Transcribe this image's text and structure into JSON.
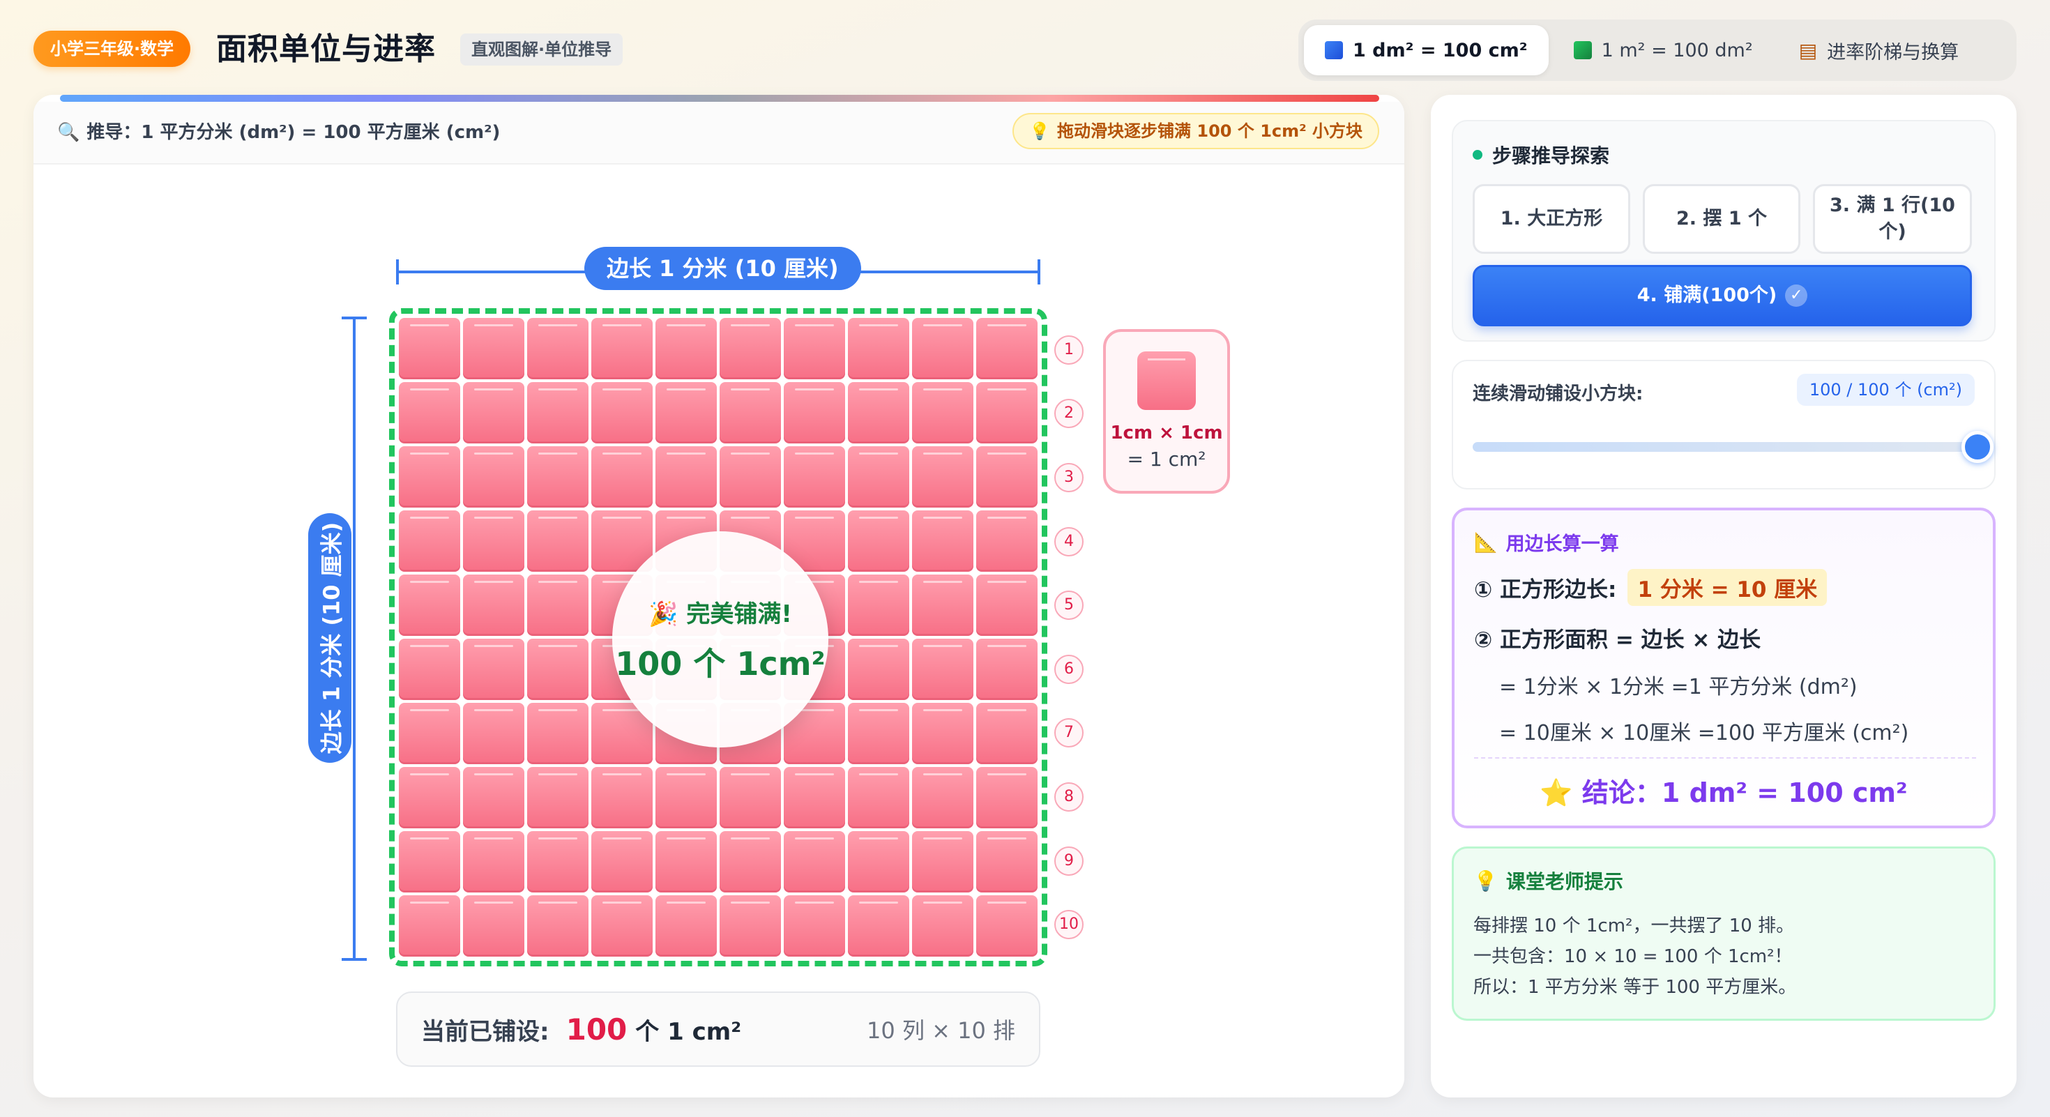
{
  "header": {
    "grade_badge": "小学三年级·数学",
    "title": "面积单位与进率",
    "subtitle": "直观图解·单位推导",
    "tabs": [
      {
        "label": "1 dm² = 100 cm²",
        "icon": "blue-square-icon",
        "active": true
      },
      {
        "label": "1 m² = 100 dm²",
        "icon": "green-square-icon",
        "active": false
      },
      {
        "label": "进率阶梯与换算",
        "icon": "ladder-icon",
        "active": false
      }
    ]
  },
  "main": {
    "derive_label": "推导：1 平方分米 (dm²) = 100 平方厘米 (cm²)",
    "hint": "拖动滑块逐步铺满 100 个 1cm² 小方块",
    "dim_top_label": "边长 1 分米 (10 厘米)",
    "dim_left_label": "边长 1 分米 (10 厘米)",
    "grid": {
      "columns": 10,
      "rows": 10,
      "filled": 100
    },
    "row_numbers": [
      "1",
      "2",
      "3",
      "4",
      "5",
      "6",
      "7",
      "8",
      "9",
      "10"
    ],
    "success": {
      "title": "完美铺满!",
      "count": "100 个 1cm²"
    },
    "unit_card": {
      "line1": "1cm × 1cm",
      "line2": "= 1 cm²"
    },
    "status": {
      "label": "当前已铺设:",
      "count": "100",
      "unit": "个 1 cm²",
      "dims": "10 列 × 10 排"
    }
  },
  "side": {
    "steps": {
      "title": "步骤推导探索",
      "buttons": [
        {
          "label": "1. 大正方形",
          "active": false
        },
        {
          "label": "2. 摆 1 个",
          "active": false
        },
        {
          "label": "3. 满 1 行(10个)",
          "active": false
        },
        {
          "label": "4. 铺满(100个)",
          "active": true
        }
      ]
    },
    "slider": {
      "label": "连续滑动铺设小方块:",
      "value_text": "100 / 100 个 (cm²)",
      "value": 100,
      "max": 100
    },
    "calc": {
      "title": "用边长算一算",
      "line1_prefix": "① 正方形边长:",
      "line1_value": "1 分米 = 10 厘米",
      "line2": "② 正方形面积 = 边长 × 边长",
      "sub1": "= 1分米 × 1分米 =1 平方分米 (dm²)",
      "sub2": "= 10厘米 × 10厘米 =100 平方厘米 (cm²)",
      "conclusion": "结论：1 dm² = 100 cm²"
    },
    "tips": {
      "title": "课堂老师提示",
      "lines": [
        "每排摆 10 个 1cm²，一共摆了 10 排。",
        "一共包含：10 × 10 = 100 个 1cm²！",
        "所以：1 平方分米 等于 100 平方厘米。"
      ]
    }
  },
  "colors": {
    "accent": "#3b7cf0",
    "tile": "#f76f86",
    "success": "#22c55e",
    "purple": "#7c3aed"
  }
}
